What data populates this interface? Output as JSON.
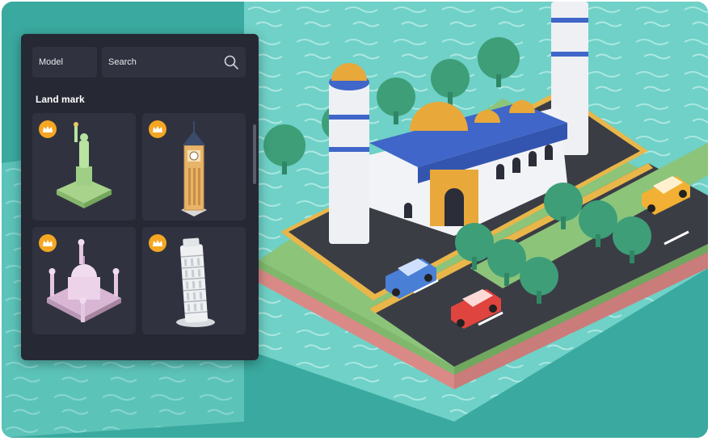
{
  "panel": {
    "model_label": "Model",
    "search_placeholder": "Search",
    "section_title": "Land mark",
    "items": [
      {
        "name": "Statue of Liberty",
        "premium": true
      },
      {
        "name": "Big Ben",
        "premium": true
      },
      {
        "name": "Taj Mahal",
        "premium": true
      },
      {
        "name": "Leaning Tower of Pisa",
        "premium": true
      }
    ]
  },
  "colors": {
    "panel_bg": "#262834",
    "card_bg": "#30333f",
    "badge": "#f5a623",
    "water": "#3aa99f",
    "grass": "#8cc47a",
    "road": "#3b3d45",
    "mosque_blue": "#3f66c8",
    "dome_gold": "#e8a83a"
  }
}
